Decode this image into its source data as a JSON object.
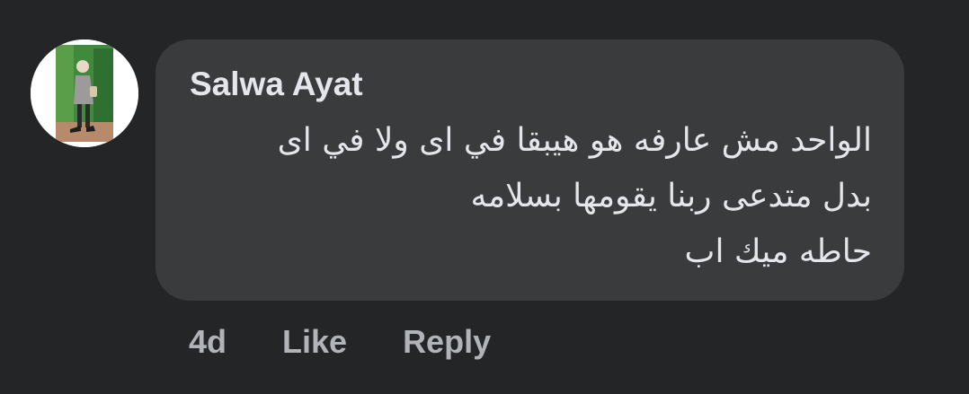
{
  "comment": {
    "author": "Salwa Ayat",
    "avatar_icon": "profile-photo-icon",
    "text_lines": [
      "الواحد مش عارفه هو هيبقا في اى ولا في اى",
      "بدل متدعى ربنا يقومها بسلامه",
      "حاطه ميك اب"
    ],
    "timestamp": "4d",
    "like_label": "Like",
    "reply_label": "Reply"
  },
  "colors": {
    "background": "#242526",
    "bubble": "#3a3b3c",
    "primary_text": "#e4e6eb",
    "secondary_text": "#b0b3b8"
  }
}
